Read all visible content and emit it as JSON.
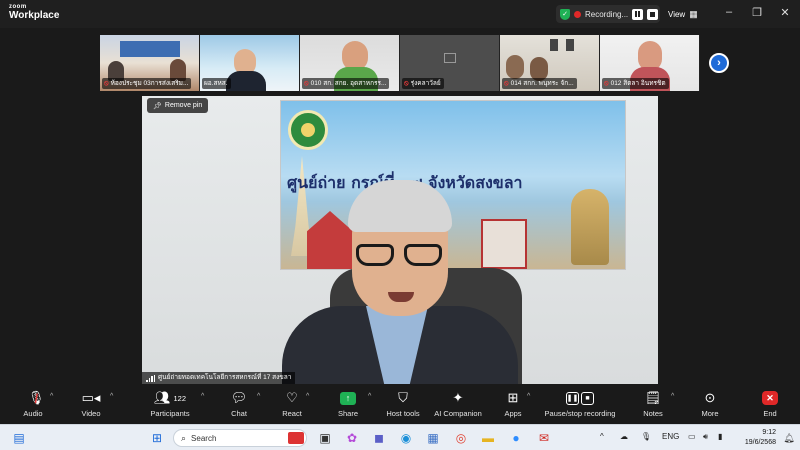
{
  "titlebar": {
    "app_line1": "zoom",
    "app_line2": "Workplace",
    "recording_label": "Recording...",
    "view_label": "View",
    "colors": {
      "bg": "#1f1f1f",
      "record_red": "#e02828",
      "secure_green": "#1fb155"
    }
  },
  "participants_strip": [
    {
      "name": "ห้องประชุม 03การส่งเสริม..."
    },
    {
      "name": "ผอ.สหส."
    },
    {
      "name": "010 สก. สกย. อุดสาหกรร..."
    },
    {
      "name": "รุ่งคลาวัลย์"
    },
    {
      "name": "014 สกก. พนุทระ จัก..."
    },
    {
      "name": "012 สิตลา อินทรชิต"
    }
  ],
  "main_video": {
    "remove_pin_label": "Remove pin",
    "speaker_name": "ศูนย์ถ่ายทอดเทคโนโลยีการสหกรณ์ที่ 17 สงขลา",
    "banner_text": "ศูนย์ถ่าย                    กรณ์ที่ ๑๗ จังหวัดสงขลา"
  },
  "toolbar": {
    "audio": "Audio",
    "video": "Video",
    "participants": "Participants",
    "participants_count": "122",
    "chat": "Chat",
    "react": "React",
    "share": "Share",
    "host_tools": "Host tools",
    "ai_companion": "AI Companion",
    "apps": "Apps",
    "pause_stop": "Pause/stop recording",
    "notes": "Notes",
    "more": "More",
    "end": "End"
  },
  "taskbar": {
    "search_placeholder": "Search",
    "lang": "ENG",
    "time": "9:12",
    "date": "19/6/2568"
  }
}
